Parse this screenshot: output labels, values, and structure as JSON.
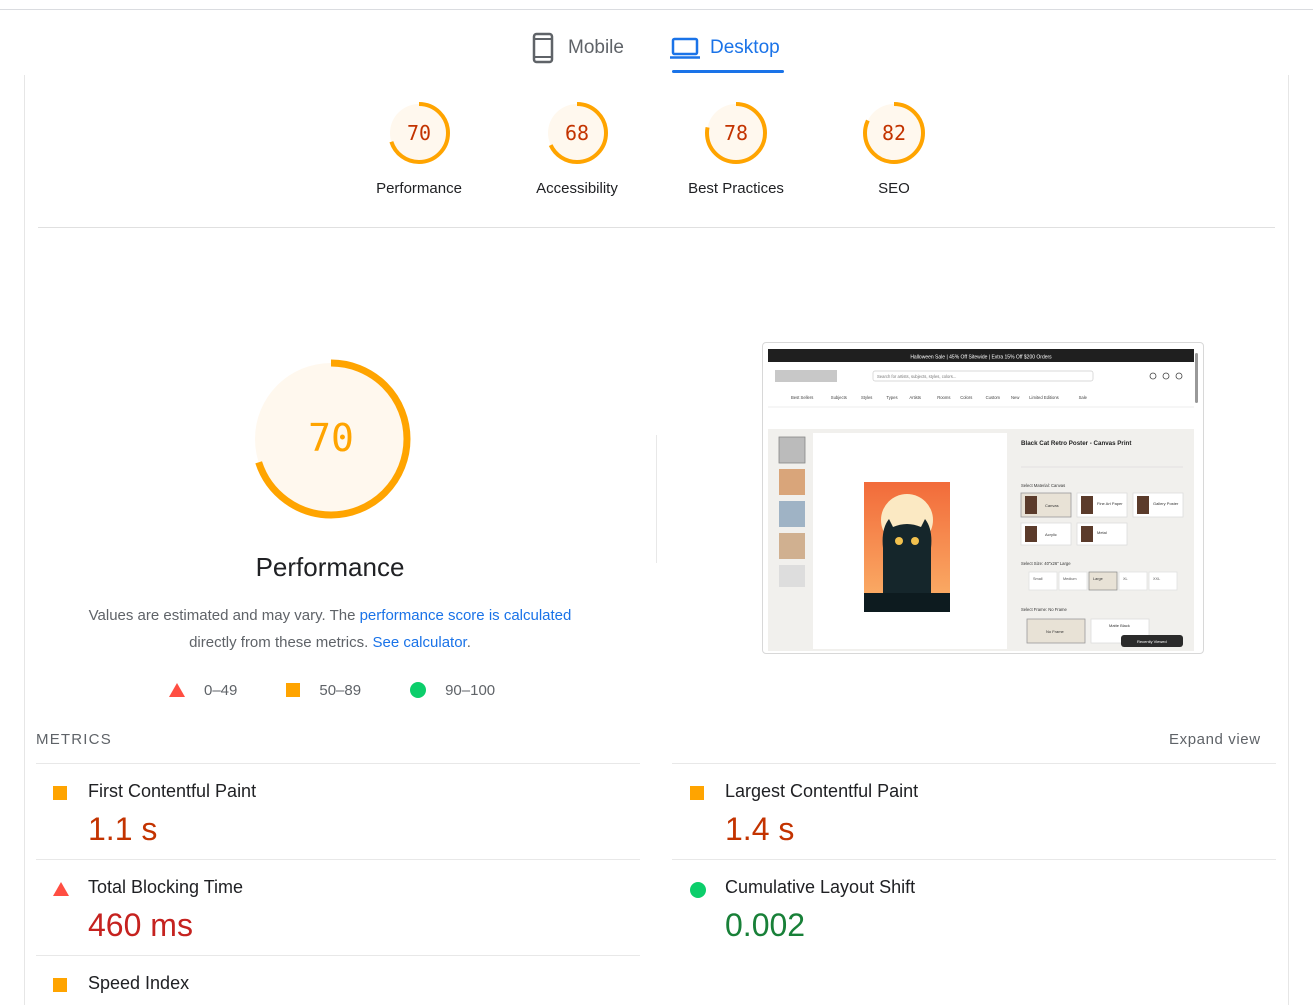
{
  "tabs": {
    "mobile_label": "Mobile",
    "desktop_label": "Desktop"
  },
  "categories": [
    {
      "score": "70",
      "label": "Performance",
      "value": 70
    },
    {
      "score": "68",
      "label": "Accessibility",
      "value": 68
    },
    {
      "score": "78",
      "label": "Best Practices",
      "value": 78
    },
    {
      "score": "82",
      "label": "SEO",
      "value": 82
    }
  ],
  "performance": {
    "score": "70",
    "value": 70,
    "title": "Performance",
    "desc_pre": "Values are estimated and may vary. The ",
    "desc_link": "performance score is calculated",
    "desc_mid": "directly from these metrics. ",
    "desc_link2": "See calculator",
    "desc_post": "."
  },
  "legend": {
    "fail": "0–49",
    "average": "50–89",
    "pass": "90–100"
  },
  "screenshot": {
    "banner": "Halloween Sale | 45% Off Sitewide | Extra 15% Off $200 Orders",
    "search_placeholder": "Search for artists, subjects, styles, colors...",
    "nav": [
      "Best Sellers",
      "Subjects",
      "Styles",
      "Types",
      "Artists",
      "Rooms",
      "Colors",
      "Custom",
      "New",
      "Limited Editions",
      "Sale"
    ],
    "product_title": "Black Cat Retro Poster - Canvas Print",
    "material_label": "Select Material: Canvas",
    "materials": [
      "Canvas",
      "Fine Art Paper",
      "Gallery Poster",
      "Acrylic",
      "Metal"
    ],
    "size_label": "Select Size: 40\"x26\" Large",
    "sizes": [
      "Small",
      "Medium",
      "Large",
      "XL",
      "XXL"
    ],
    "frame_label": "Select Frame: No Frame",
    "frames": [
      "No Frame",
      "Matte Black"
    ],
    "recently_viewed": "Recently Viewed"
  },
  "metrics": {
    "heading": "METRICS",
    "expand": "Expand view",
    "items": [
      {
        "name": "First Contentful Paint",
        "value": "1.1 s",
        "status": "average"
      },
      {
        "name": "Largest Contentful Paint",
        "value": "1.4 s",
        "status": "average"
      },
      {
        "name": "Total Blocking Time",
        "value": "460 ms",
        "status": "fail"
      },
      {
        "name": "Cumulative Layout Shift",
        "value": "0.002",
        "status": "pass"
      },
      {
        "name": "Speed Index",
        "value": "",
        "status": "average"
      }
    ]
  },
  "colors": {
    "accent": "#1a73e8",
    "average": "#ffa400",
    "average_text": "#c33300",
    "fail": "#ff4e42",
    "pass": "#0cce6b"
  }
}
